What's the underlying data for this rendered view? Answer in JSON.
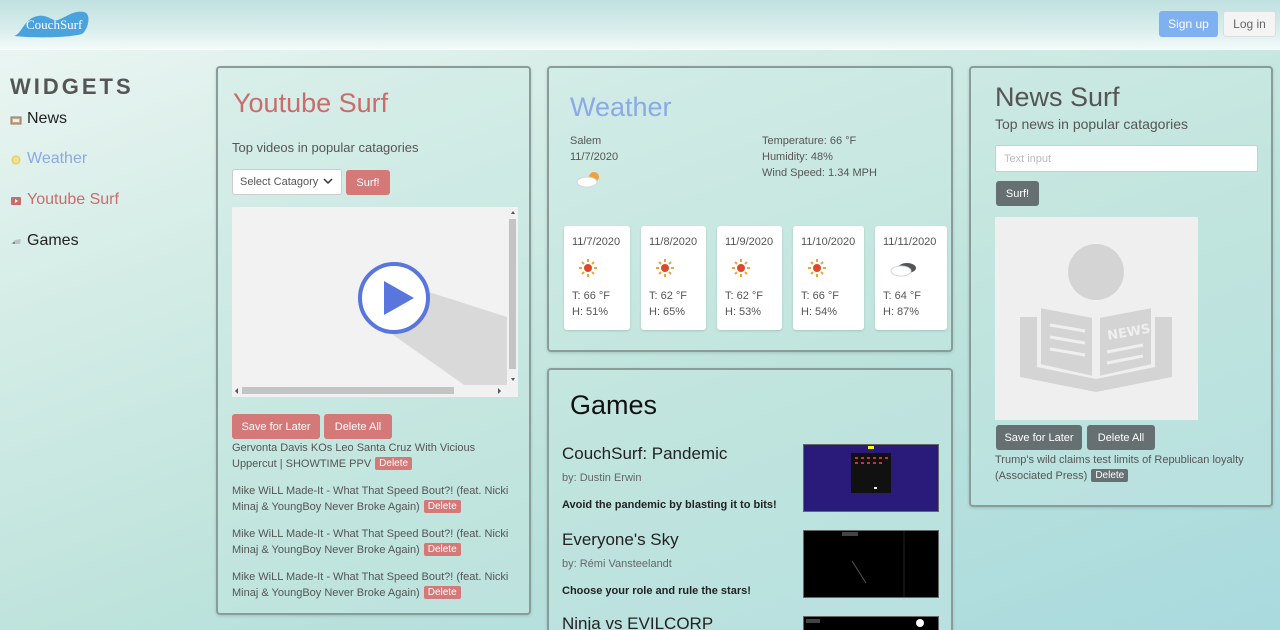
{
  "header": {
    "logo_text": "CouchSurf",
    "signup_label": "Sign up",
    "login_label": "Log in"
  },
  "sidebar": {
    "title": "WIDGETS",
    "items": [
      {
        "label": "News",
        "icon": "news-icon",
        "color": "#222222"
      },
      {
        "label": "Weather",
        "icon": "sun-icon",
        "color": "#8aa9e8"
      },
      {
        "label": "Youtube Surf",
        "icon": "youtube-icon",
        "color": "#c96c6c"
      },
      {
        "label": "Games",
        "icon": "gamepad-icon",
        "color": "#222222"
      }
    ]
  },
  "youtube": {
    "title": "Youtube Surf",
    "subtitle": "Top videos in popular catagories",
    "select_value": "Select Catagory",
    "surf_label": "Surf!",
    "save_label": "Save for Later",
    "delete_all_label": "Delete All",
    "delete_label": "Delete",
    "saved": [
      "Gervonta Davis KOs Leo Santa Cruz With Vicious Uppercut | SHOWTIME PPV",
      "Mike WiLL Made-It - What That Speed Bout?! (feat. Nicki Minaj & YoungBoy Never Broke Again)",
      "Mike WiLL Made-It - What That Speed Bout?! (feat. Nicki Minaj & YoungBoy Never Broke Again)",
      "Mike WiLL Made-It - What That Speed Bout?! (feat. Nicki Minaj & YoungBoy Never Broke Again)"
    ]
  },
  "weather": {
    "title": "Weather",
    "city": "Salem",
    "date": "11/7/2020",
    "temperature": "Temperature: 66 °F",
    "humidity": "Humidity: 48%",
    "wind": "Wind Speed: 1.34 MPH",
    "forecast": [
      {
        "date": "11/7/2020",
        "temp": "T: 66 °F",
        "humidity": "H: 51%",
        "icon": "sun-icon"
      },
      {
        "date": "11/8/2020",
        "temp": "T: 62 °F",
        "humidity": "H: 65%",
        "icon": "sun-icon"
      },
      {
        "date": "11/9/2020",
        "temp": "T: 62 °F",
        "humidity": "H: 53%",
        "icon": "sun-icon"
      },
      {
        "date": "11/10/2020",
        "temp": "T: 66 °F",
        "humidity": "H: 54%",
        "icon": "sun-icon"
      },
      {
        "date": "11/11/2020",
        "temp": "T: 64 °F",
        "humidity": "H: 87%",
        "icon": "cloud-icon"
      }
    ]
  },
  "games": {
    "title": "Games",
    "items": [
      {
        "name": "CouchSurf: Pandemic",
        "author": "by: Dustin Erwin",
        "description": "Avoid the pandemic by blasting it to bits!"
      },
      {
        "name": "Everyone's Sky",
        "author": "by: Rémi Vansteelandt",
        "description": "Choose your role and rule the stars!"
      },
      {
        "name": "Ninja vs EVILCORP",
        "author": "",
        "description": ""
      }
    ]
  },
  "news": {
    "title": "News Surf",
    "subtitle": "Top news in popular catagories",
    "input_placeholder": "Text input",
    "surf_label": "Surf!",
    "save_label": "Save for Later",
    "delete_all_label": "Delete All",
    "delete_label": "Delete",
    "saved": [
      "Trump's wild claims test limits of Republican loyalty (Associated Press)"
    ]
  }
}
